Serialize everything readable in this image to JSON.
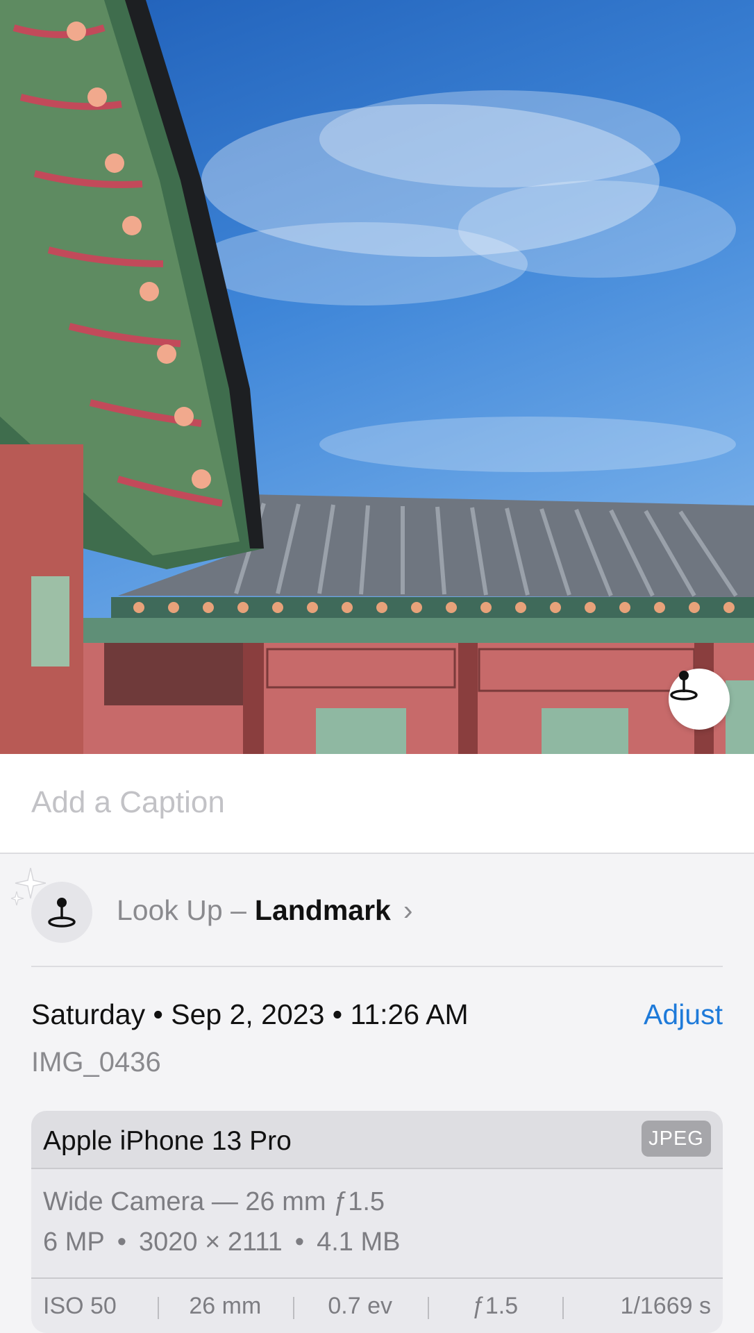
{
  "caption": {
    "placeholder": "Add a Caption"
  },
  "lookup": {
    "prefix": "Look Up –",
    "subject": "Landmark",
    "chevron": "›"
  },
  "datetime": {
    "text": "Saturday • Sep 2, 2023 • 11:26 AM",
    "adjust_label": "Adjust"
  },
  "filename": "IMG_0436",
  "device": {
    "name": "Apple iPhone 13 Pro",
    "format": "JPEG",
    "lens": "Wide Camera — 26 mm ƒ1.5",
    "megapixels": "6 MP",
    "resolution": "3020 × 2111",
    "size": "4.1 MB",
    "separator": "•"
  },
  "exif": {
    "iso": "ISO 50",
    "focal": "26 mm",
    "ev": "0.7 ev",
    "aperture": "ƒ1.5",
    "shutter": "1/1669 s"
  },
  "colors": {
    "accent": "#1e7ad9",
    "sky": "#3f86d8",
    "wall": "#c76a6a",
    "roof_green": "#4f7a52"
  },
  "icons": {
    "visual_lookup": "visual-lookup-pin-icon",
    "sparkle": "sparkle-icon",
    "chevron": "chevron-right-icon"
  }
}
